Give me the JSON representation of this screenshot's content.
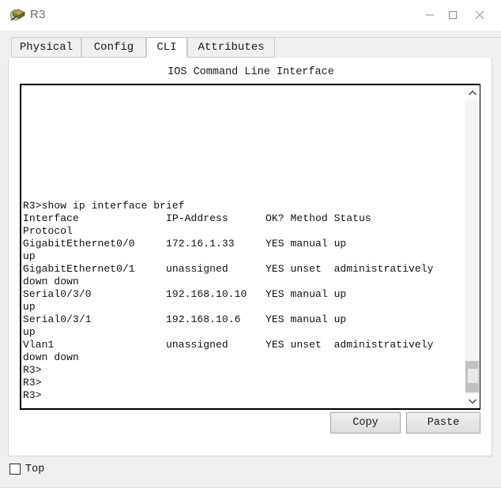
{
  "window": {
    "title": "R3",
    "icon": "router-device-icon",
    "controls": {
      "minimize": "minimize-icon",
      "maximize": "maximize-icon",
      "close": "close-icon"
    }
  },
  "tabs": [
    {
      "label": "Physical",
      "active": false
    },
    {
      "label": "Config",
      "active": false
    },
    {
      "label": "CLI",
      "active": true
    },
    {
      "label": "Attributes",
      "active": false
    }
  ],
  "main": {
    "heading": "IOS Command Line Interface",
    "terminal": {
      "lines": [
        "",
        "",
        "",
        "",
        "",
        "",
        "",
        "",
        "",
        "R3>show ip interface brief",
        "Interface              IP-Address      OK? Method Status",
        "Protocol",
        "GigabitEthernet0/0     172.16.1.33     YES manual up",
        "up",
        "GigabitEthernet0/1     unassigned      YES unset  administratively",
        "down down",
        "Serial0/3/0            192.168.10.10   YES manual up",
        "up",
        "Serial0/3/1            192.168.10.6    YES manual up",
        "up",
        "Vlan1                  unassigned      YES unset  administratively",
        "down down",
        "R3>",
        "R3>",
        "R3>"
      ],
      "command": "show ip interface brief",
      "prompt": "R3>",
      "table": {
        "headers": [
          "Interface",
          "IP-Address",
          "OK?",
          "Method",
          "Status",
          "Protocol"
        ],
        "rows": [
          [
            "GigabitEthernet0/0",
            "172.16.1.33",
            "YES",
            "manual",
            "up",
            "up"
          ],
          [
            "GigabitEthernet0/1",
            "unassigned",
            "YES",
            "unset",
            "administratively down",
            "down"
          ],
          [
            "Serial0/3/0",
            "192.168.10.10",
            "YES",
            "manual",
            "up",
            "up"
          ],
          [
            "Serial0/3/1",
            "192.168.10.6",
            "YES",
            "manual",
            "up",
            "up"
          ],
          [
            "Vlan1",
            "unassigned",
            "YES",
            "unset",
            "administratively down",
            "down"
          ]
        ]
      }
    },
    "scrollbar": {
      "up_arrow": "chevron-up-icon",
      "down_arrow": "chevron-down-icon",
      "thumb_position": "bottom"
    },
    "buttons": {
      "copy": "Copy",
      "paste": "Paste"
    }
  },
  "footer": {
    "top_checkbox": {
      "label": "Top",
      "checked": false
    }
  },
  "colors": {
    "window_bg": "#f0f0f0",
    "panel_bg": "#ffffff",
    "terminal_text": "#101010",
    "terminal_border": "#000000",
    "title_text": "#707070",
    "button_face": "#e6e6e6",
    "scroll_thumb": "#c2c2c2"
  }
}
